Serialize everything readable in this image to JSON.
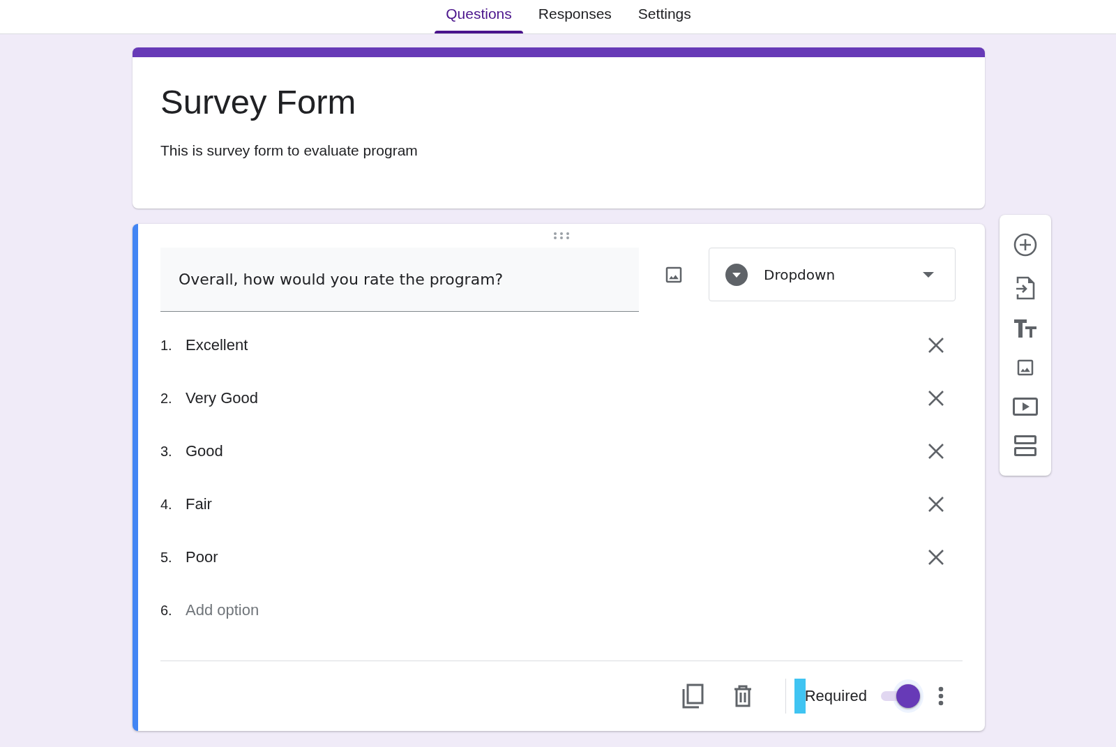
{
  "tabs": [
    {
      "label": "Questions",
      "selected": true
    },
    {
      "label": "Responses",
      "selected": false
    },
    {
      "label": "Settings",
      "selected": false
    }
  ],
  "form_header": {
    "title": "Survey Form",
    "description": "This is survey form to evaluate program"
  },
  "question": {
    "text": "Overall, how would you rate the program?",
    "type_label": "Dropdown",
    "options": [
      {
        "kind": "option",
        "number": "1.",
        "label": "Excellent"
      },
      {
        "kind": "option",
        "number": "2.",
        "label": "Very Good"
      },
      {
        "kind": "option",
        "number": "3.",
        "label": "Good"
      },
      {
        "kind": "option",
        "number": "4.",
        "label": "Fair"
      },
      {
        "kind": "option",
        "number": "5.",
        "label": "Poor"
      },
      {
        "kind": "add",
        "number": "6.",
        "label": "Add option"
      }
    ],
    "required_label": "Required",
    "required_on": true
  }
}
